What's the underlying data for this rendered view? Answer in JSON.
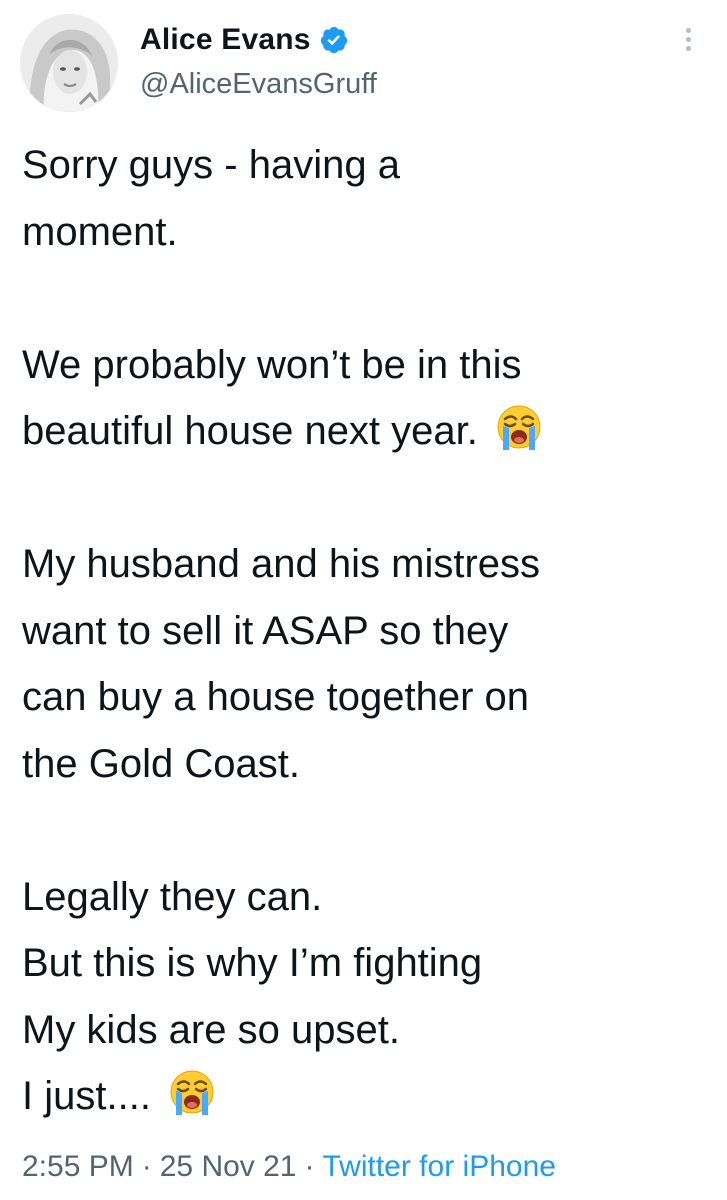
{
  "author": {
    "display_name": "Alice Evans",
    "handle": "@AliceEvansGruff",
    "verified": true
  },
  "tweet": {
    "lines": [
      "Sorry guys - having a",
      "moment.",
      "",
      "We probably won’t be in this",
      "beautiful house next year.",
      "",
      "My husband and his mistress",
      "want to sell it ASAP so they",
      "can buy a house together on",
      "the Gold Coast.",
      "",
      "Legally they can.",
      "But this is why I’m fighting",
      "My kids are so upset.",
      "I just...."
    ],
    "emoji": [
      "loudly-crying-face-icon",
      "loudly-crying-face-icon"
    ]
  },
  "meta": {
    "time": "2:55 PM",
    "date": "25 Nov 21",
    "separator": "·",
    "source": "Twitter for iPhone"
  },
  "colors": {
    "text": "#0f1419",
    "secondary": "#536471",
    "link": "#1d9bf0",
    "verified": "#1d9bf0"
  }
}
